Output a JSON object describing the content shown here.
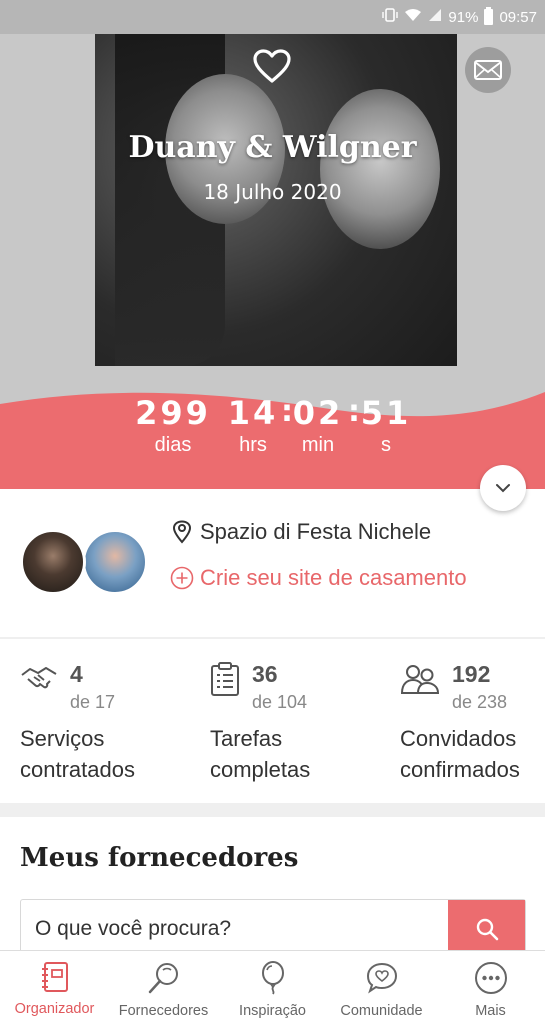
{
  "status_bar": {
    "battery": "91%",
    "time": "09:57"
  },
  "hero": {
    "couple": "Duany & Wilgner",
    "date": "18 Julho 2020"
  },
  "countdown": {
    "days": "299",
    "days_label": "dias",
    "hours": "14",
    "hours_label": "hrs",
    "minutes": "02",
    "minutes_label": "min",
    "seconds": "51",
    "seconds_label": "s"
  },
  "info": {
    "venue": "Spazio di Festa Nichele",
    "website_cta": "Crie seu site de casamento"
  },
  "stats": [
    {
      "value": "4",
      "of": "de 17",
      "label": "Serviços contratados",
      "icon": "handshake-icon"
    },
    {
      "value": "36",
      "of": "de 104",
      "label": "Tarefas completas",
      "icon": "clipboard-icon"
    },
    {
      "value": "192",
      "of": "de 238",
      "label": "Convidados confirmados",
      "icon": "guests-icon"
    }
  ],
  "suppliers": {
    "title": "Meus fornecedores",
    "search_placeholder": "O que você procura?"
  },
  "nav": [
    {
      "label": "Organizador",
      "icon": "planner-icon",
      "active": true
    },
    {
      "label": "Fornecedores",
      "icon": "search-vendors-icon"
    },
    {
      "label": "Inspiração",
      "icon": "balloon-icon"
    },
    {
      "label": "Comunidade",
      "icon": "community-icon"
    },
    {
      "label": "Mais",
      "icon": "more-icon"
    }
  ],
  "colors": {
    "accent": "#ec6c6f",
    "accent_text": "#e8676a"
  }
}
